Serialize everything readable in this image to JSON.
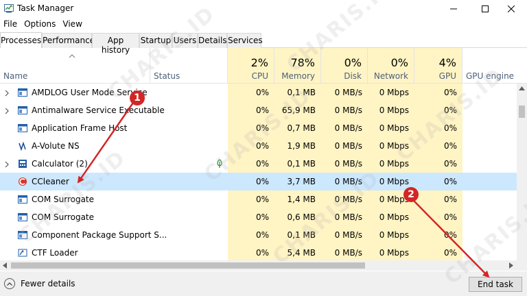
{
  "window": {
    "title": "Task Manager",
    "minimize_icon": "minimize-icon",
    "maximize_icon": "maximize-icon",
    "close_icon": "close-icon"
  },
  "menu": [
    "File",
    "Options",
    "View"
  ],
  "tabs": [
    "Processes",
    "Performance",
    "App history",
    "Startup",
    "Users",
    "Details",
    "Services"
  ],
  "active_tab": "Processes",
  "header": {
    "name": "Name",
    "status": "Status",
    "cpu": {
      "pct": "2%",
      "label": "CPU"
    },
    "memory": {
      "pct": "78%",
      "label": "Memory"
    },
    "disk": {
      "pct": "0%",
      "label": "Disk"
    },
    "network": {
      "pct": "0%",
      "label": "Network"
    },
    "gpu": {
      "pct": "4%",
      "label": "GPU"
    },
    "gpu_engine": "GPU engine"
  },
  "processes": [
    {
      "name": "AMDLOG User Mode Service",
      "expandable": true,
      "icon": "app-window-icon",
      "cpu": "0%",
      "memory": "0,1 MB",
      "disk": "0 MB/s",
      "network": "0 Mbps",
      "gpu": "0%"
    },
    {
      "name": "Antimalware Service Executable",
      "expandable": true,
      "icon": "app-window-icon",
      "cpu": "0%",
      "memory": "65,9 MB",
      "disk": "0 MB/s",
      "network": "0 Mbps",
      "gpu": "0%"
    },
    {
      "name": "Application Frame Host",
      "expandable": false,
      "icon": "app-window-icon",
      "cpu": "0%",
      "memory": "0,7 MB",
      "disk": "0 MB/s",
      "network": "0 Mbps",
      "gpu": "0%"
    },
    {
      "name": "A-Volute NS",
      "expandable": false,
      "icon": "avolute-icon",
      "cpu": "0%",
      "memory": "1,9 MB",
      "disk": "0 MB/s",
      "network": "0 Mbps",
      "gpu": "0%"
    },
    {
      "name": "Calculator (2)",
      "expandable": true,
      "icon": "calculator-icon",
      "suspended": true,
      "cpu": "0%",
      "memory": "0,1 MB",
      "disk": "0 MB/s",
      "network": "0 Mbps",
      "gpu": "0%"
    },
    {
      "name": "CCleaner",
      "expandable": false,
      "icon": "ccleaner-icon",
      "selected": true,
      "cpu": "0%",
      "memory": "3,7 MB",
      "disk": "0 MB/s",
      "network": "0 Mbps",
      "gpu": "0%"
    },
    {
      "name": "COM Surrogate",
      "expandable": false,
      "icon": "app-window-icon",
      "cpu": "0%",
      "memory": "1,4 MB",
      "disk": "0 MB/s",
      "network": "0 Mbps",
      "gpu": "0%"
    },
    {
      "name": "COM Surrogate",
      "expandable": false,
      "icon": "app-window-icon",
      "cpu": "0%",
      "memory": "0,6 MB",
      "disk": "0 MB/s",
      "network": "0 Mbps",
      "gpu": "0%"
    },
    {
      "name": "Component Package Support S...",
      "expandable": false,
      "icon": "app-window-icon",
      "cpu": "0%",
      "memory": "0,1 MB",
      "disk": "0 MB/s",
      "network": "0 Mbps",
      "gpu": "0%"
    },
    {
      "name": "CTF Loader",
      "expandable": false,
      "icon": "ctf-loader-icon",
      "cpu": "0%",
      "memory": "5,4 MB",
      "disk": "0 MB/s",
      "network": "0 Mbps",
      "gpu": "0%"
    }
  ],
  "footer": {
    "fewer_details": "Fewer details",
    "end_task": "End task"
  },
  "annotations": {
    "badge1": "1",
    "badge2": "2",
    "watermark": "CHARIS.ID"
  },
  "colors": {
    "accent_red": "#d32626",
    "selection": "#cce8ff",
    "heat_yellow": "#fff4c4"
  }
}
